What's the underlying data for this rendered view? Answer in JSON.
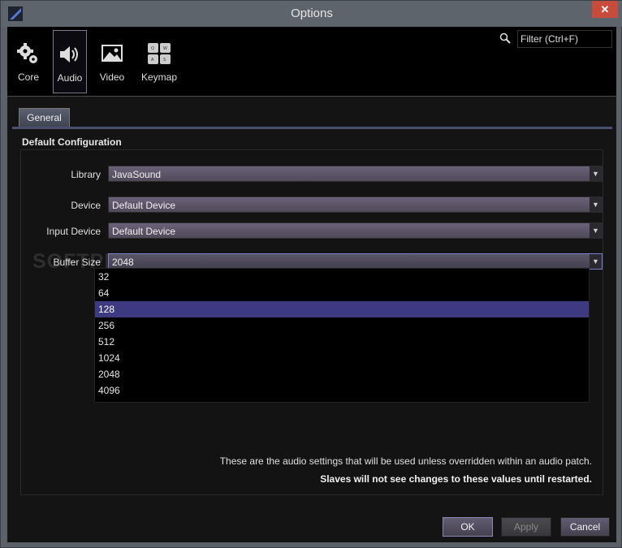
{
  "window": {
    "title": "Options",
    "close_glyph": "✕"
  },
  "toolbar": {
    "items": [
      {
        "label": "Core",
        "icon": "gear-icon"
      },
      {
        "label": "Audio",
        "icon": "speaker-icon"
      },
      {
        "label": "Video",
        "icon": "image-icon"
      },
      {
        "label": "Keymap",
        "icon": "keyboard-icon"
      }
    ],
    "active": "Audio",
    "filter": {
      "placeholder": "Filter (Ctrl+F)",
      "value": ""
    }
  },
  "tabs": [
    {
      "label": "General"
    }
  ],
  "section": {
    "title": "Default Configuration"
  },
  "fields": {
    "library": {
      "label": "Library",
      "value": "JavaSound"
    },
    "device": {
      "label": "Device",
      "value": "Default Device"
    },
    "input_device": {
      "label": "Input Device",
      "value": "Default Device"
    },
    "buffer_size": {
      "label": "Buffer Size",
      "value": "2048"
    }
  },
  "dropdown": {
    "options": [
      "32",
      "64",
      "128",
      "256",
      "512",
      "1024",
      "2048",
      "4096"
    ],
    "highlighted": "128"
  },
  "watermark": "SOFTPEDIA",
  "notes": {
    "line1": "These are the audio settings that will be used unless overridden within an audio patch.",
    "line2": "Slaves will not see changes to these values until restarted."
  },
  "buttons": {
    "ok": "OK",
    "apply": "Apply",
    "cancel": "Cancel"
  },
  "colors": {
    "accent": "#3d3a82",
    "titlebar": "#5d646b",
    "close": "#c74c3c"
  }
}
